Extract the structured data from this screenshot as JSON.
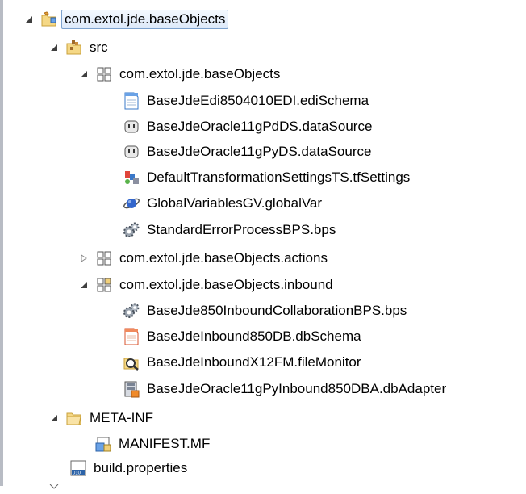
{
  "tree": {
    "project": {
      "label": "com.extol.jde.baseObjects",
      "icon": "project-folder-icon"
    },
    "src": {
      "label": "src",
      "icon": "source-folder-icon"
    },
    "pkg_base": {
      "label": "com.extol.jde.baseObjects",
      "icon": "package-icon"
    },
    "files_base": [
      {
        "label": "BaseJdeEdi8504010EDI.ediSchema",
        "icon": "edi-schema-file-icon"
      },
      {
        "label": "BaseJdeOracle11gPdDS.dataSource",
        "icon": "plug-icon"
      },
      {
        "label": "BaseJdeOracle11gPyDS.dataSource",
        "icon": "plug-icon"
      },
      {
        "label": "DefaultTransformationSettingsTS.tfSettings",
        "icon": "transformation-settings-icon"
      },
      {
        "label": "GlobalVariablesGV.globalVar",
        "icon": "globe-icon"
      },
      {
        "label": "StandardErrorProcessBPS.bps",
        "icon": "gears-icon"
      }
    ],
    "pkg_actions": {
      "label": "com.extol.jde.baseObjects.actions",
      "icon": "package-icon"
    },
    "pkg_inbound": {
      "label": "com.extol.jde.baseObjects.inbound",
      "icon": "package-icon"
    },
    "files_inbound": [
      {
        "label": "BaseJde850InboundCollaborationBPS.bps",
        "icon": "gears-icon"
      },
      {
        "label": "BaseJdeInbound850DB.dbSchema",
        "icon": "db-schema-file-icon"
      },
      {
        "label": "BaseJdeInboundX12FM.fileMonitor",
        "icon": "file-monitor-icon"
      },
      {
        "label": "BaseJdeOracle11gPyInbound850DBA.dbAdapter",
        "icon": "db-adapter-icon"
      }
    ],
    "meta_inf": {
      "label": "META-INF",
      "icon": "folder-icon"
    },
    "manifest": {
      "label": "MANIFEST.MF",
      "icon": "manifest-file-icon"
    },
    "build": {
      "label": "build.properties",
      "icon": "properties-file-icon"
    }
  }
}
